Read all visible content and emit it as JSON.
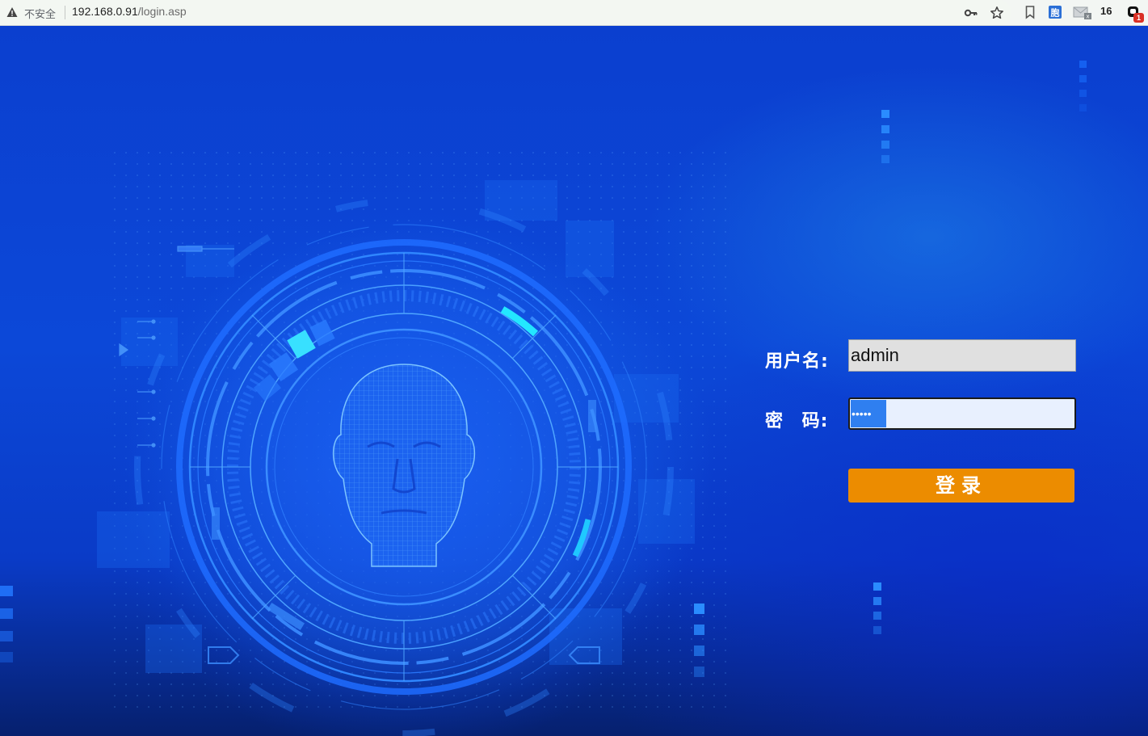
{
  "browser": {
    "security_text": "不安全",
    "url_host": "192.168.0.91",
    "url_path": "/login.asp",
    "extension_count": "16",
    "notification_badge": "1",
    "icons": [
      "warning-icon",
      "key-icon",
      "star-icon",
      "bookmark-icon",
      "translate-extension-icon",
      "mail-extension-icon",
      "puzzle-extension-icon"
    ]
  },
  "login": {
    "username_label": "用户名:",
    "username_value": "admin",
    "password_label": "密 码:",
    "password_masked": "•••••",
    "submit_label": "登录"
  },
  "colors": {
    "background": "#0a3fd0",
    "button": "#ec8c00",
    "field_user_bg": "#e0e0e0",
    "field_pass_bg": "#e8f0fe"
  }
}
